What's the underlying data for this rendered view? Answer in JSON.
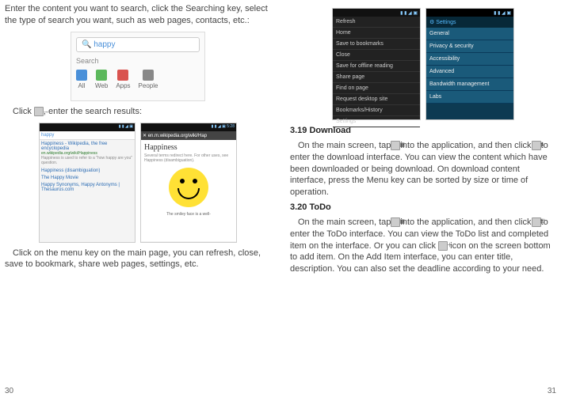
{
  "left": {
    "para1": "Enter the content you want to search, click the Searching key, select the type of search you want, such as web pages, contacts, etc.:",
    "searchbox": {
      "query": "happy",
      "label": "Search",
      "tabs": [
        "All",
        "Web",
        "Apps",
        "People"
      ]
    },
    "para2_a": "Click ",
    "para2_b": ", enter the search results:",
    "result_left": {
      "query": "happy",
      "t1": "Happiness - Wikipedia, the free encyclopedia",
      "u1": "en.wikipedia.org/wiki/Happiness",
      "d1": "Happiness is used to refer to a \"how happy are you\" question.",
      "t2": "Happiness (disambiguation)",
      "t3": "The Happy Movie",
      "t4": "Happy Synonyms, Happy Antonyms | Thesaurus.com"
    },
    "result_right": {
      "url": "en.m.wikipedia.org/wiki/Hap",
      "title": "Happiness",
      "caption": "The smiley face is a well-"
    },
    "para3": "Click on the menu key on the main page, you can refresh, close, save to bookmark, share web pages, settings, etc.",
    "pagenum": "30"
  },
  "right": {
    "phone1": {
      "items": [
        "Refresh",
        "Home",
        "Save to bookmarks",
        "Close",
        "Save for offline reading",
        "Share page",
        "Find on page",
        "Request desktop site",
        "Bookmarks/History",
        "Settings"
      ]
    },
    "phone2": {
      "header": "Settings",
      "items": [
        "General",
        "Privacy & security",
        "Accessibility",
        "Advanced",
        "Bandwidth management",
        "Labs"
      ]
    },
    "h1": "3.19 Download",
    "p1a": "On the main screen, tap",
    "p1b": "into the application, and then click",
    "p1c": "to enter the download interface. You can view the content which have been downloaded or being download. On download content interface, press the Menu key can be sorted by size or time of operation.",
    "h2": "3.20 ToDo",
    "p2a": "On the main screen, tap",
    "p2b": "into the application, and then click",
    "p2c": "to enter the ToDo interface. You can view the ToDo list and completed item on the interface. Or you can click",
    "p2d": " icon on the screen bottom to add item. On the Add Item interface, you can enter title, description. You can also set the deadline according to your need.",
    "pagenum": "31"
  }
}
